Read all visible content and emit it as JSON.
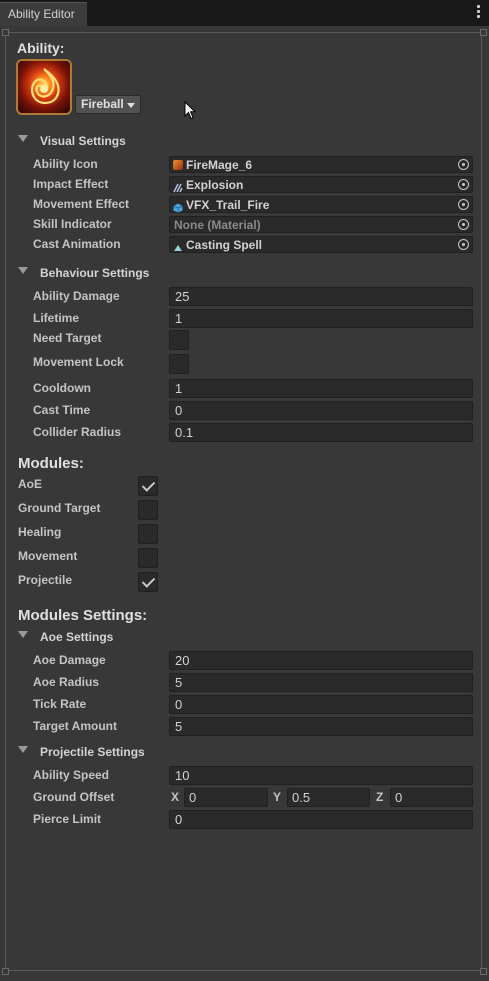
{
  "window": {
    "tab_title": "Ability Editor",
    "menu_icon": "kebab-menu-icon"
  },
  "ability": {
    "heading": "Ability:",
    "icon_name": "fireball-ability-icon",
    "selected": "Fireball"
  },
  "visual_settings": {
    "title": "Visual Settings",
    "rows": [
      {
        "label": "Ability Icon",
        "value": "FireMage_6",
        "icon": "sprite-icon"
      },
      {
        "label": "Impact Effect",
        "value": "Explosion",
        "icon": "vfx-icon"
      },
      {
        "label": "Movement Effect",
        "value": "VFX_Trail_Fire",
        "icon": "prefab-icon"
      },
      {
        "label": "Skill Indicator",
        "value": "None (Material)",
        "icon": ""
      },
      {
        "label": "Cast Animation",
        "value": "Casting Spell",
        "icon": "animation-clip-icon"
      }
    ]
  },
  "behaviour_settings": {
    "title": "Behaviour Settings",
    "ability_damage": {
      "label": "Ability Damage",
      "value": "25"
    },
    "lifetime": {
      "label": "Lifetime",
      "value": "1"
    },
    "need_target": {
      "label": "Need Target",
      "checked": false
    },
    "movement_lock": {
      "label": "Movement Lock",
      "checked": false
    },
    "cooldown": {
      "label": "Cooldown",
      "value": "1"
    },
    "cast_time": {
      "label": "Cast Time",
      "value": "0"
    },
    "collider_radius": {
      "label": "Collider Radius",
      "value": "0.1"
    }
  },
  "modules": {
    "heading": "Modules:",
    "items": [
      {
        "label": "AoE",
        "checked": true
      },
      {
        "label": "Ground Target",
        "checked": false
      },
      {
        "label": "Healing",
        "checked": false
      },
      {
        "label": "Movement",
        "checked": false
      },
      {
        "label": "Projectile",
        "checked": true
      }
    ]
  },
  "modules_settings": {
    "heading": "Modules Settings:",
    "aoe": {
      "title": "Aoe Settings",
      "rows": [
        {
          "label": "Aoe Damage",
          "value": "20"
        },
        {
          "label": "Aoe Radius",
          "value": "5"
        },
        {
          "label": "Tick Rate",
          "value": "0"
        },
        {
          "label": "Target Amount",
          "value": "5"
        }
      ]
    },
    "projectile": {
      "title": "Projectile Settings",
      "ability_speed": {
        "label": "Ability Speed",
        "value": "10"
      },
      "ground_offset": {
        "label": "Ground Offset",
        "x_label": "X",
        "x": "0",
        "y_label": "Y",
        "y": "0.5",
        "z_label": "Z",
        "z": "0"
      },
      "pierce_limit": {
        "label": "Pierce Limit",
        "value": "0"
      }
    }
  },
  "colors": {
    "panel_bg": "#383838",
    "field_bg": "#2a2a2a",
    "tab_bg": "#3c3c3c"
  }
}
